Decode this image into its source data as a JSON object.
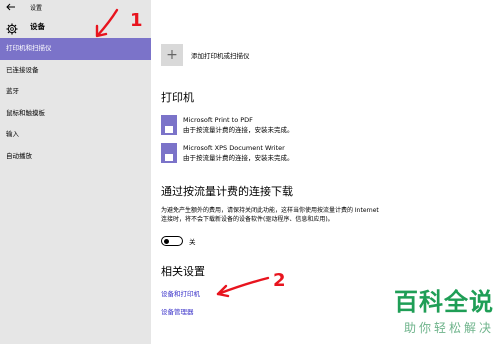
{
  "window": {
    "title": "设置"
  },
  "header": {
    "title": "设备"
  },
  "sidebar": {
    "items": [
      {
        "label": "打印机和扫描仪",
        "active": true
      },
      {
        "label": "已连接设备",
        "active": false
      },
      {
        "label": "蓝牙",
        "active": false
      },
      {
        "label": "鼠标和触摸板",
        "active": false
      },
      {
        "label": "输入",
        "active": false
      },
      {
        "label": "自动播放",
        "active": false
      }
    ]
  },
  "main": {
    "add_label": "添加打印机或扫描仪",
    "printers_title": "打印机",
    "printers": [
      {
        "name": "Microsoft Print to PDF",
        "status": "由于按流量计费的连接，安装未完成。"
      },
      {
        "name": "Microsoft XPS Document Writer",
        "status": "由于按流量计费的连接，安装未完成。"
      }
    ],
    "metered_title": "通过按流量计费的连接下载",
    "metered_desc": "为避免产生额外的费用，请保持关闭此功能，这样当你使用按流量计费的 Internet 连接时，将不会下载新设备的设备软件(驱动程序、信息和应用)。",
    "toggle_label": "关",
    "toggle_on": false,
    "related_title": "相关设置",
    "links": [
      "设备和打印机",
      "设备管理器"
    ]
  },
  "annotations": {
    "num1": "1",
    "num2": "2"
  },
  "watermark": {
    "main": "百科全说",
    "sub": "助你轻松解决"
  },
  "colors": {
    "accent": "#7b73c9",
    "link": "#3a32c9",
    "annotation": "#e8141e",
    "watermark": "#1f9e56"
  }
}
